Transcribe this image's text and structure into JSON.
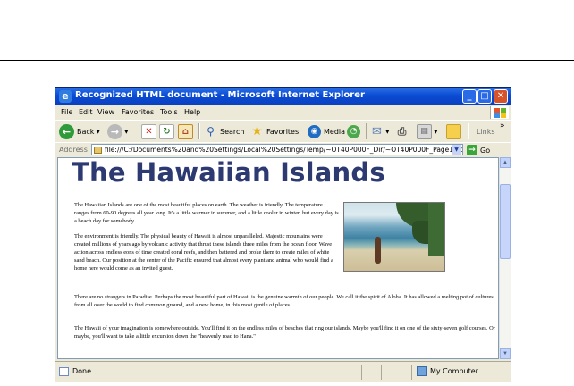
{
  "window": {
    "title": "Recognized HTML document - Microsoft Internet Explorer",
    "app_icon": "ie-logo-icon"
  },
  "menu": {
    "items": [
      "File",
      "Edit",
      "View",
      "Favorites",
      "Tools",
      "Help"
    ]
  },
  "toolbar": {
    "back_label": "Back",
    "search_label": "Search",
    "favorites_label": "Favorites",
    "media_label": "Media",
    "links_label": "Links",
    "chevron": "»"
  },
  "address": {
    "label": "Address",
    "value": "file:///C:/Documents%20and%20Settings/Local%20Settings/Temp/~OT40P000F_Dir/~OT40P000F_Page1.htm#655",
    "go_label": "Go"
  },
  "page": {
    "heading": "The Hawaiian Islands",
    "paragraphs": [
      "The Hawaiian Islands are one of the most beautiful places on earth. The weather is friendly. The temperature ranges from 60-90 degrees all year long. It's a little warmer in summer, and a little cooler in winter, but every day is a beach day for somebody.",
      "The environment is friendly. The physical beauty of Hawaii is almost unparalleled. Majestic mountains were created millions of years ago by volcanic activity that thrust these islands three miles from the ocean floor. Wave action across endless eons of time created coral reefs, and then battered and broke them to create miles of white sand beach. Our position at the center of the Pacific ensured that almost every plant and animal who would find a home here would come as an invited guest.",
      "There are no strangers in Paradise. Perhaps the most beautiful part of Hawaii is the genuine warmth of our people. We call it the spirit of Aloha. It has allowed a melting pot of cultures from all over the world to find common ground, and a new home, in this most gentle of places.",
      "The Hawaii of your imagination is somewhere outside. You'll find it on the endless miles of beaches that ring our islands. Maybe you'll find it on one of the sixty-seven golf courses. Or maybe, you'll want to take a little excursion down the \"heavenly road to Hana.\""
    ]
  },
  "status": {
    "text": "Done",
    "zone": "My Computer"
  },
  "colors": {
    "titlebar": "#0a4bd3",
    "heading": "#2d3a72",
    "chrome": "#ece9d8"
  }
}
